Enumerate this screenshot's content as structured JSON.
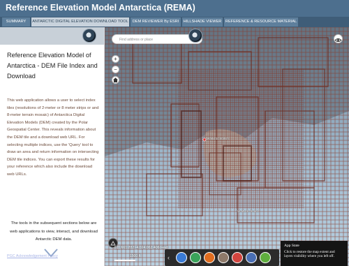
{
  "header": {
    "title": "Reference Elevation Model Antarctica (REMA)"
  },
  "tabs": [
    {
      "label": "SUMMARY",
      "active": false
    },
    {
      "label": "ANTARCTIC DIGITAL ELEVATION DOWNLOAD TOOL",
      "active": true
    },
    {
      "label": "DEM REVIEWER By ESRI",
      "active": false
    },
    {
      "label": "HILLSHADE VIEWER",
      "active": false
    },
    {
      "label": "REFERENCE & RESOURCE MATERIAL",
      "active": false
    }
  ],
  "panel": {
    "title": "Reference Elevation Model of Antarctica - DEM File Index and Download",
    "description": "This web application allows a user to select index tiles (resolutions of 2-meter or 8 meter strips or and 8-meter terrain mosaic) of Antarctica Digital Elevation Models (DEM) created by the Polar Geospatial Center. This reveals information about the DEM tile and a download web URL. For selecting multiple indices, use the 'Query' tool to draw an area and return information on intersecting DEM tile indices. You can export these results for your reference which also include the download web URLs.",
    "tools_text": "The tools in the subsequent sections below are web applications to view, interact, and download Antarctic DEM data.",
    "footer_link": "PGC Acknowledgement Policy"
  },
  "map": {
    "search": {
      "placeholder": "Find address or place"
    },
    "zoom_in_label": "+",
    "zoom_out_label": "−",
    "coords": "-611,661.282 -4,024,062.406 Feet",
    "scale": "1500 ft",
    "labels": {
      "station": "McMurdo Station",
      "sound": "McMurdo Sound"
    },
    "tile_color": "#8a3b2b",
    "ice_color": "#a9c3d6",
    "land_color": "#b6b0a6"
  },
  "toolbar": {
    "tools": [
      {
        "name": "layer-list-icon",
        "color": "#3a7bd5"
      },
      {
        "name": "basemap-icon",
        "color": "#3aa35a"
      },
      {
        "name": "query-icon",
        "color": "#e06d1f"
      },
      {
        "name": "print-icon",
        "color": "#8e7a6a"
      },
      {
        "name": "measure-icon",
        "color": "#d2453f"
      },
      {
        "name": "select-icon",
        "color": "#4a6fb5"
      },
      {
        "name": "draw-icon",
        "color": "#5fae3e"
      }
    ]
  },
  "tooltip": {
    "title": "App State",
    "body": "Click to restore the map extent and layers visibility where you left off."
  }
}
